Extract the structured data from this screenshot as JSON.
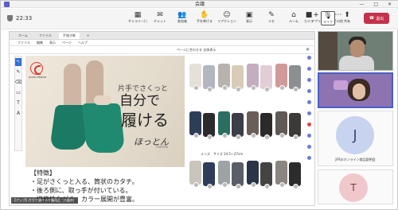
{
  "window": {
    "title": "会議",
    "controls": "— □ ✕"
  },
  "toolbar": {
    "time": "22:33",
    "items": [
      {
        "icon": "gallery-icon",
        "glyph": "▦",
        "label": "ギャラリー(プラス)"
      },
      {
        "icon": "chat-icon",
        "glyph": "✉",
        "label": "チャット"
      },
      {
        "icon": "people-icon",
        "glyph": "👥",
        "label": "参加者"
      },
      {
        "icon": "raise-hand-icon",
        "glyph": "✋",
        "label": "手を挙げる"
      },
      {
        "icon": "react-icon",
        "glyph": "☺",
        "label": "リアクション"
      },
      {
        "icon": "view-icon",
        "glyph": "▣",
        "label": "表示"
      },
      {
        "icon": "notes-icon",
        "glyph": "✎",
        "label": "メモ"
      },
      {
        "icon": "rooms-icon",
        "glyph": "⌂",
        "label": "ルーム"
      },
      {
        "icon": "apps-icon",
        "glyph": "+",
        "label": "アプリ"
      },
      {
        "icon": "more-icon",
        "glyph": "⋯",
        "label": "その他"
      }
    ],
    "right_items": [
      {
        "icon": "camera-icon",
        "glyph": "■",
        "label": "カメラ"
      },
      {
        "icon": "mic-icon",
        "glyph": "🎙",
        "label": "マイク"
      },
      {
        "icon": "share-icon",
        "glyph": "⬆",
        "label": "共有"
      }
    ],
    "leave_label": "退出"
  },
  "browser": {
    "tabs": [
      "ホーム",
      "ファイル",
      "手描き帳",
      "+"
    ]
  },
  "app_menu": [
    "ファイル",
    "編集",
    "表示",
    "ページ",
    "ヘルプ"
  ],
  "doc_toolbar": {
    "zoom": "ページに合わせる  全体表示",
    "close": "✕"
  },
  "tools": [
    "↖",
    "✎",
    "⌫",
    "▭",
    "T",
    "A"
  ],
  "product": {
    "catch1": "片手でさくっと",
    "catch2": "自分で",
    "catch3": "履ける",
    "catch4": "ほっとん",
    "brand": "matilda",
    "logo_text": "GOOD DESIGN",
    "features": [
      "【特徴】",
      "・足がさくっと入る、筒状のカタチ。",
      "・後ろ側に、取っ手が付いている。",
      "・機能性ながら、カラー展開が豊富。"
    ],
    "size_label": "メンズ　サイズ 24.5〜27cm",
    "colors": [
      [
        "#e6e1d8",
        "#b8b2ad",
        "#c3aec0",
        "#d19a9a",
        "#b3b6be",
        "#d8ccb8",
        "#e3cdd5",
        "#8c8f92"
      ],
      [
        "#2e3d56",
        "#2b6f62",
        "#6a5e58",
        "#5f5a56",
        "#2b2b2e",
        "#3b3e48",
        "#2a2a2a",
        "#3d3938"
      ],
      [
        "#c9c4bc",
        "#9ea3a6",
        "#2a3447",
        "#8a8580",
        "#2f3d5a",
        "#5a5e66",
        "#444",
        "#2c2c2c"
      ]
    ]
  },
  "caption": "【アップ】片手で履ける介護用品（大阪府）",
  "participants": {
    "j_initial": "J",
    "j_name": "JFRのオンライン商品説明会",
    "t_initial": "T"
  }
}
